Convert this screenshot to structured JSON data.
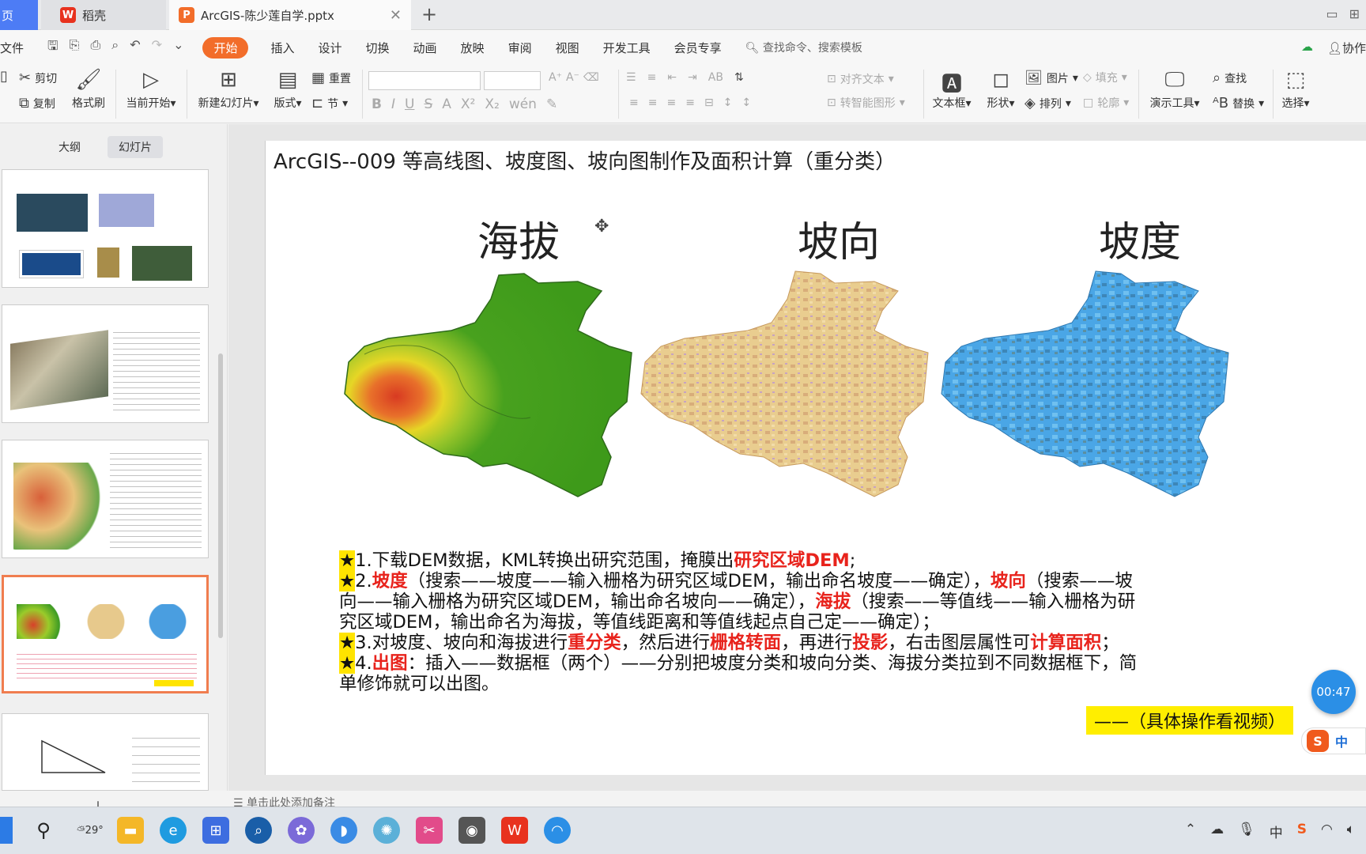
{
  "tabs": {
    "home": "页",
    "daoke": "稻壳",
    "active": "ArcGIS-陈少莲自学.pptx"
  },
  "menu": {
    "file": "文件",
    "items": [
      "开始",
      "插入",
      "设计",
      "切换",
      "动画",
      "放映",
      "审阅",
      "视图",
      "开发工具",
      "会员专享"
    ],
    "search": "查找命令、搜索模板",
    "collab": "协作"
  },
  "ribbon": {
    "cut": "剪切",
    "copy": "复制",
    "format_painter": "格式刷",
    "play_from_current": "当前开始",
    "new_slide": "新建幻灯片",
    "layout": "版式",
    "reset": "重置",
    "section": "节",
    "align_text": "对齐文本",
    "smartart": "转智能图形",
    "textbox": "文本框",
    "shapes": "形状",
    "picture": "图片",
    "arrange": "排列",
    "fill": "填充",
    "outline": "轮廓",
    "presenter": "演示工具",
    "find": "查找",
    "replace": "替换",
    "select": "选择"
  },
  "panel": {
    "outline_tab": "大纲",
    "slides_tab": "幻灯片"
  },
  "slide": {
    "title": "ArcGIS--009   等高线图、坡度图、坡向图制作及面积计算（重分类）",
    "label_elevation": "海拔",
    "label_aspect": "坡向",
    "label_slope": "坡度",
    "p1_a": "1.下载DEM数据，KML转换出研究范围，掩膜出",
    "p1_b": "研究区域DEM",
    "p1_c": ";",
    "p2_a": "2.",
    "p2_b": "坡度",
    "p2_c": "（搜索——坡度——输入栅格为研究区域DEM，输出命名坡度——确定），",
    "p2_d": "坡向",
    "p2_e": "（搜索——坡向——输入栅格为研究区域DEM，输出命名坡向——确定），",
    "p2_f": "海拔",
    "p2_g": "（搜索——等值线——输入栅格为研究区域DEM，输出命名为海拔，等值线距离和等值线起点自己定——确定）；",
    "p3_a": "3.对坡度、坡向和海拔进行",
    "p3_b": "重分类",
    "p3_c": "，然后进行",
    "p3_d": "栅格转面",
    "p3_e": "，再进行",
    "p3_f": "投影",
    "p3_g": "，右击图层属性可",
    "p3_h": "计算面积",
    "p3_i": "；",
    "p4_a": "4.",
    "p4_b": "出图",
    "p4_c": "：插入——数据框（两个）——分别把坡度分类和坡向分类、海拔分类拉到不同数据框下，简单修饰就可以出图。",
    "star": "★",
    "note": "——（具体操作看视频）"
  },
  "notes_hint": "单击此处添加备注",
  "timer": "00:47",
  "ime": "中",
  "taskbar": {
    "weather": "29°"
  },
  "colors": {
    "accent_orange": "#f26d2a",
    "highlight_red": "#e8231c",
    "highlight_yellow": "#ffe400",
    "timer_blue": "#2b8fe6"
  }
}
